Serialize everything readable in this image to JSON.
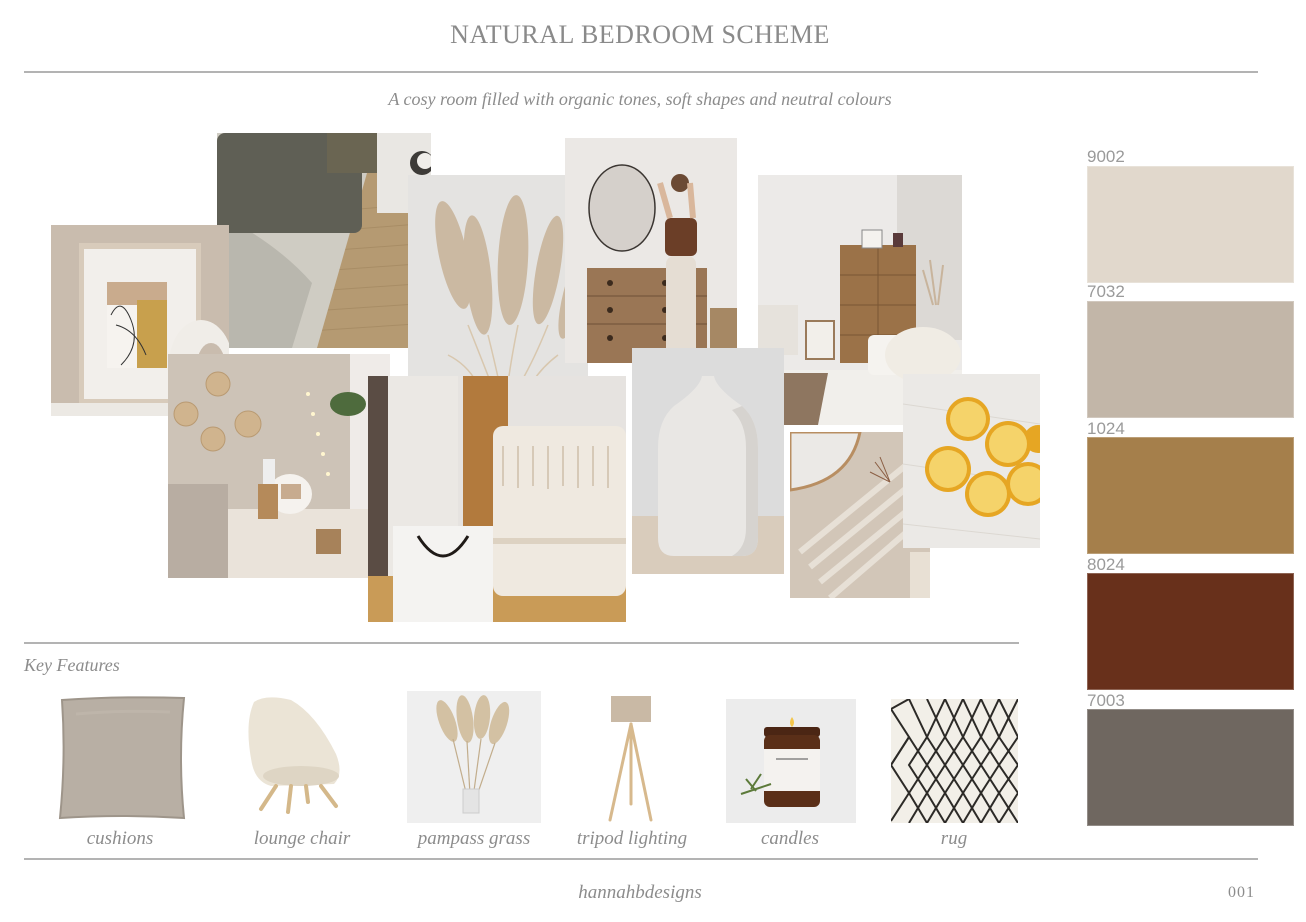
{
  "header": {
    "title": "NATURAL BEDROOM SCHEME",
    "subtitle": "A cosy room filled with organic tones, soft shapes and neutral colours"
  },
  "moodboard": {
    "images": [
      {
        "id": "line-art-frame-vase",
        "description": "line art print in frame with ring vase"
      },
      {
        "id": "linen-bed-jute-rug",
        "description": "grey linen bedding with jute rug"
      },
      {
        "id": "pampas-grass-closeup",
        "description": "pampas grass plumes"
      },
      {
        "id": "woman-mirror-dresser",
        "description": "woman at round mirror and wooden dresser"
      },
      {
        "id": "rattan-cabinet-room",
        "description": "rattan cabinet with pampas and knit throw"
      },
      {
        "id": "boho-bedroom-corner",
        "description": "boho bedroom with woven wall plates and fairy lights"
      },
      {
        "id": "fringed-cushion",
        "description": "fringed cream cushion with shopping bag"
      },
      {
        "id": "white-vase",
        "description": "matte white bottle vase"
      },
      {
        "id": "mirror-shadow-light",
        "description": "round mirror with window shadows"
      },
      {
        "id": "lemons-on-linen",
        "description": "halved lemons on white linen"
      }
    ]
  },
  "palette": {
    "swatches": [
      {
        "code": "9002",
        "color": "#e1d8cc"
      },
      {
        "code": "7032",
        "color": "#c2b6a8"
      },
      {
        "code": "1024",
        "color": "#a57f4b"
      },
      {
        "code": "8024",
        "color": "#68301b"
      },
      {
        "code": "7003",
        "color": "#6f6760"
      }
    ]
  },
  "key_features": {
    "title": "Key Features",
    "items": [
      {
        "label": "cushions"
      },
      {
        "label": "lounge chair"
      },
      {
        "label": "pampass grass"
      },
      {
        "label": "tripod lighting"
      },
      {
        "label": "candles"
      },
      {
        "label": "rug"
      }
    ]
  },
  "footer": {
    "brand": "hannahbdesigns",
    "page_number": "001"
  }
}
